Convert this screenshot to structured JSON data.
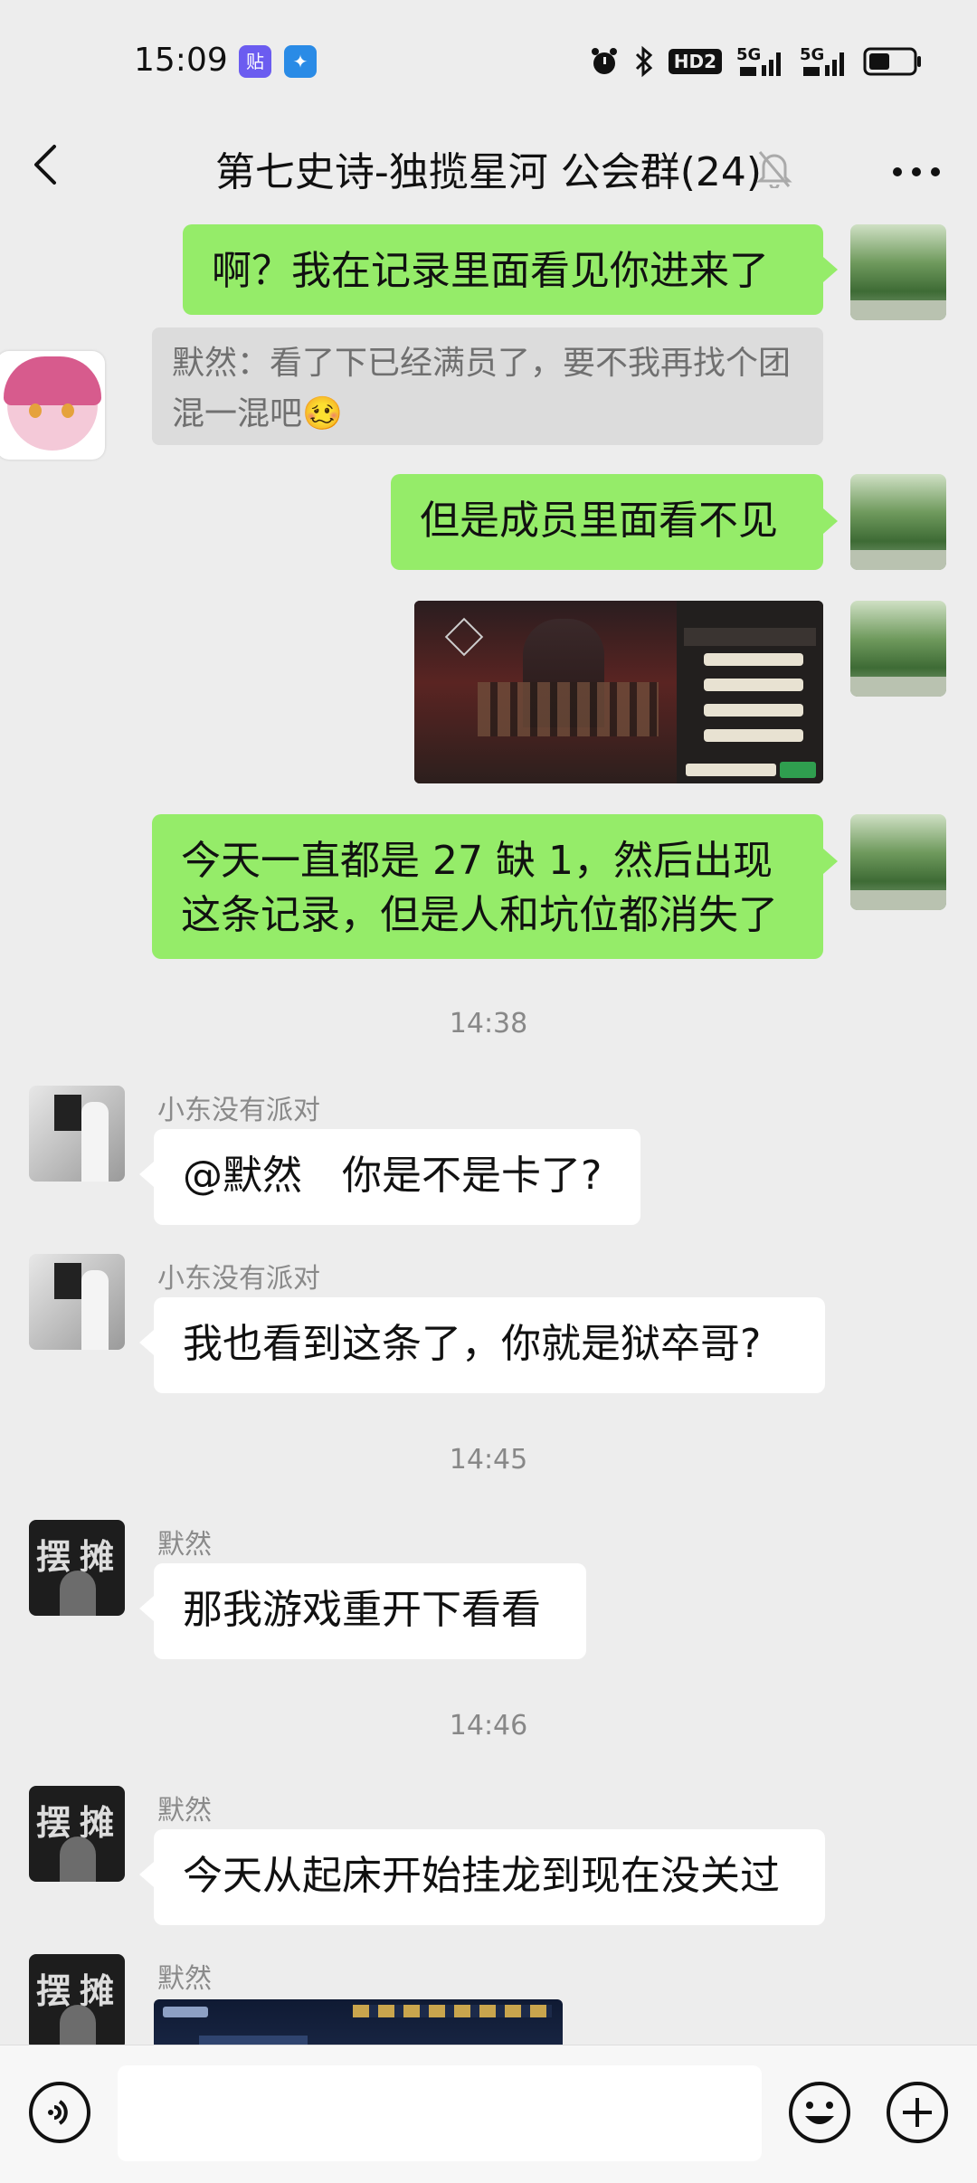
{
  "status_bar": {
    "time": "15:09",
    "badges": [
      {
        "name": "tieba-app-icon",
        "label": "贴",
        "color": "#6b5cf0"
      },
      {
        "name": "telecom-app-icon",
        "label": "✦",
        "color": "#2a8be6"
      }
    ],
    "icons": [
      "alarm-icon",
      "bluetooth-icon",
      "hd2-icon",
      "signal-5g-icon",
      "signal-5g-icon",
      "battery-icon"
    ],
    "hd_label": "HD2",
    "network_label_1": "5G",
    "network_label_2": "5G"
  },
  "header": {
    "title": "第七史诗-独揽星河 公会群(24)",
    "icons": [
      "back-icon",
      "mute-bell-icon",
      "more-icon"
    ]
  },
  "messages": {
    "m1": "啊？我在记录里面看见你进来了",
    "quote1": "默然：看了下已经满员了，要不我再找个团混一混吧",
    "quote1_emoji": "🥴",
    "m2": "但是成员里面看不见",
    "m3_line1": "今天一直都是 27 缺 1，然后出现",
    "m3_line2": "这条记录，但是人和坑位都消失了",
    "ts1": "14:38",
    "s1_name": "小东没有派对",
    "s1_msg": "@默然　你是不是卡了?",
    "s2_name": "小东没有派对",
    "s2_msg": "我也看到这条了，你就是狱卒哥?",
    "ts2": "14:45",
    "s3_name": "默然",
    "s3_msg": "那我游戏重开下看看",
    "ts3": "14:46",
    "s4_name": "默然",
    "s4_msg": "今天从起床开始挂龙到现在没关过",
    "s5_name": "默然"
  },
  "avatar_text": {
    "stall_left": "摆",
    "stall_right": "摊"
  },
  "colors": {
    "background": "#ededed",
    "my_bubble": "#95ec69",
    "their_bubble": "#ffffff",
    "quote_bg": "#dcdcdc"
  },
  "bottom_bar": {
    "icons": [
      "voice-icon",
      "emoji-icon",
      "plus-icon"
    ]
  }
}
